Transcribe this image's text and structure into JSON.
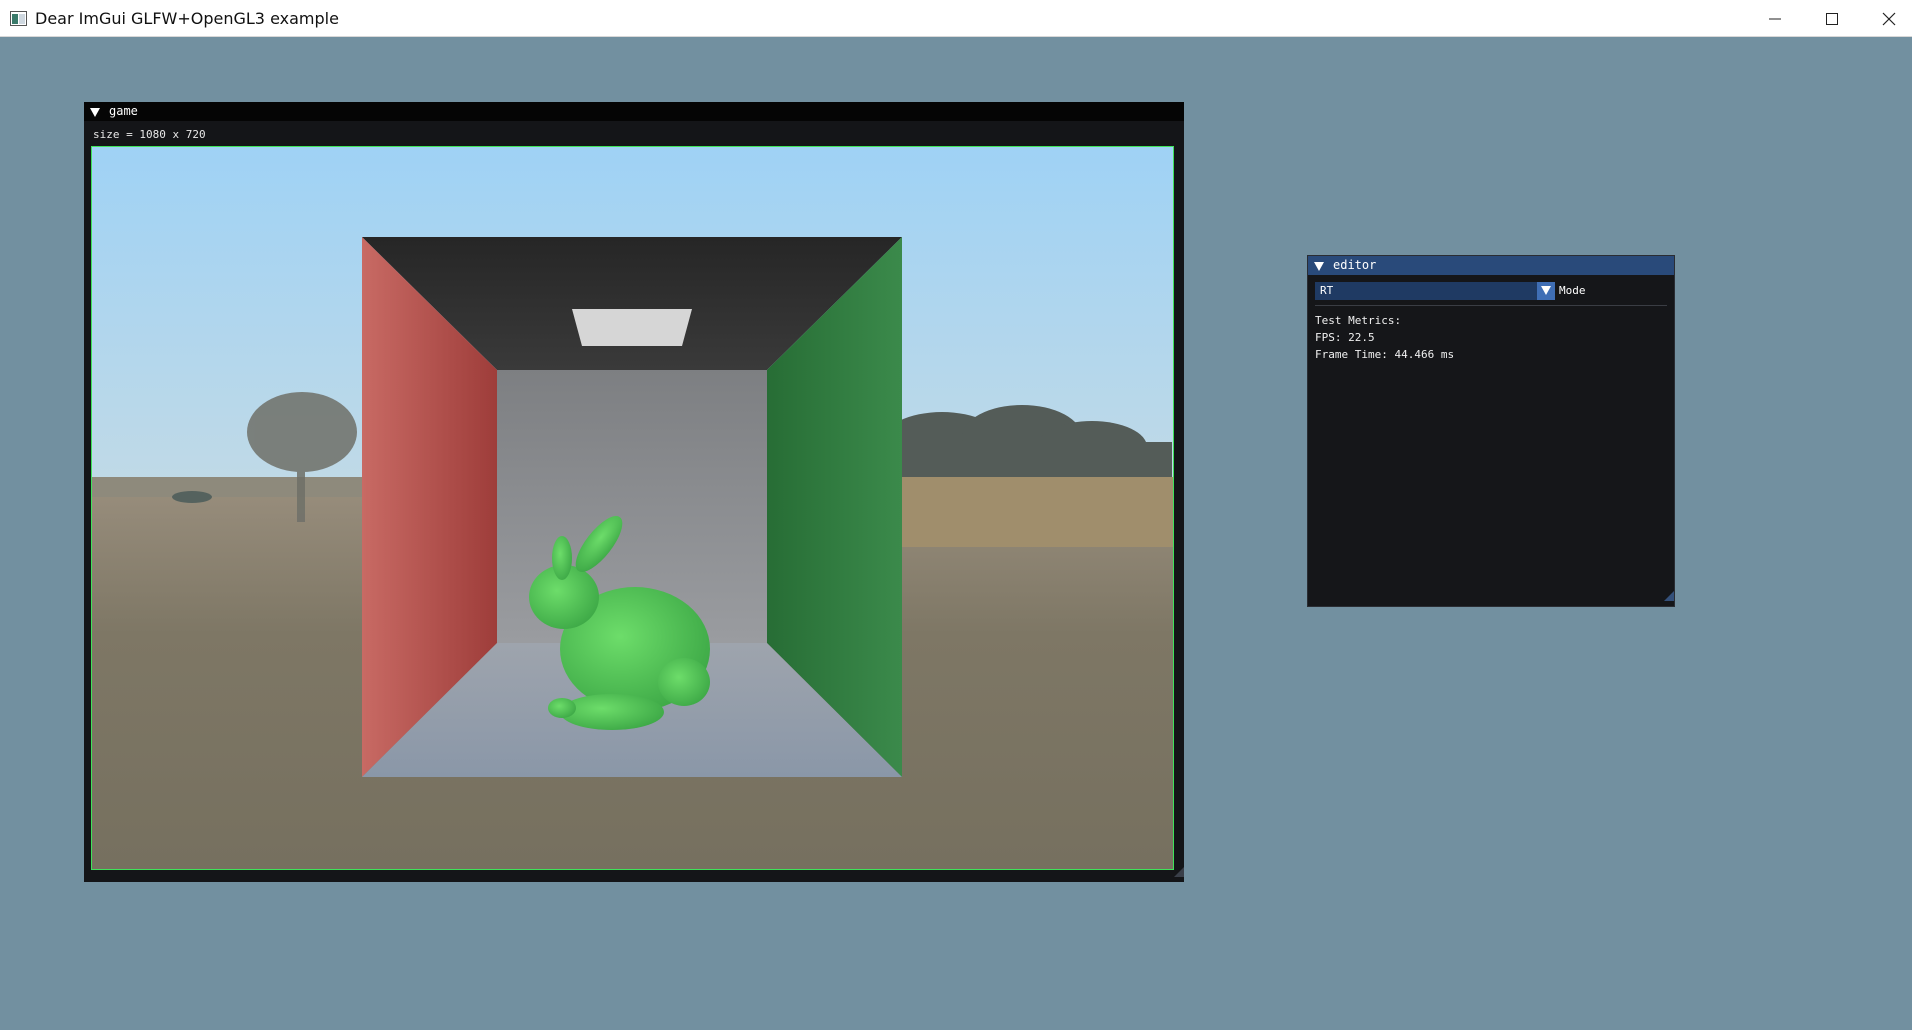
{
  "window": {
    "title": "Dear ImGui GLFW+OpenGL3 example",
    "icon": "app-window-icon",
    "controls": [
      "minimize-icon",
      "maximize-icon",
      "close-icon"
    ]
  },
  "colors": {
    "background": "#7290a0",
    "viewport_border": "#3fe35a",
    "editor_title": "#294a7a",
    "combo_bg": "#1f3a63",
    "combo_arrow": "#3f6eb5"
  },
  "game_window": {
    "title": "game",
    "size_label": "size = 1080 x 720",
    "viewport_content": "render-viewport-image"
  },
  "editor_window": {
    "title": "editor",
    "mode_combo": {
      "value": "RT",
      "label": "Mode"
    },
    "metrics_header": "Test Metrics:",
    "fps": "FPS: 22.5",
    "frame_time": "Frame Time: 44.466 ms"
  }
}
